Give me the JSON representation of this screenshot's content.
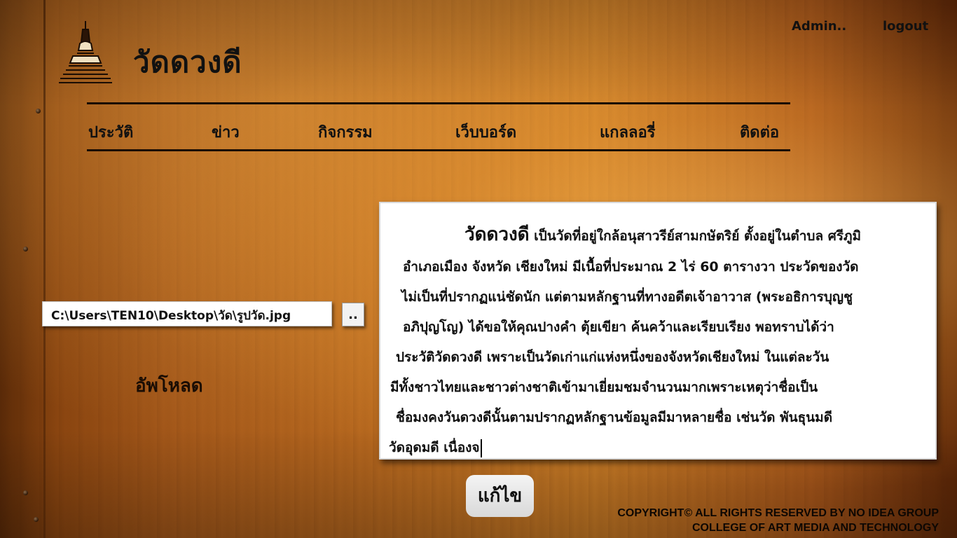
{
  "site": {
    "title": "วัดดวงดี",
    "logo_icon": "pagoda-icon"
  },
  "user": {
    "admin_label": "Admin..",
    "logout_label": "logout"
  },
  "nav": {
    "items": [
      {
        "label": "ประวัติ"
      },
      {
        "label": "ข่าว"
      },
      {
        "label": "กิจกรรม"
      },
      {
        "label": "เว็บบอร์ด"
      },
      {
        "label": "แกลลอรี่"
      },
      {
        "label": "ติดต่อ"
      }
    ]
  },
  "upload": {
    "file_path": "C:\\Users\\TEN10\\Desktop\\วัด\\รูปวัด.jpg",
    "browse_label": "..",
    "upload_label": "อัพโหลด"
  },
  "history": {
    "lead": "วัดดวงดี",
    "lines": [
      " เป็นวัดที่อยู่ใกล้อนุสาวรีย์สามกษัตริย์ ตั้งอยู่ในตำบล ศรีภูมิ",
      "อำเภอเมือง จังหวัด เชียงใหม่ มีเนื้อที่ประมาณ 2 ไร่ 60 ตารางวา ประวัดของวัด",
      "ไม่เป็นที่ปรากฏแน่ชัดนัก แต่ตามหลักฐานที่ทางอดีตเจ้าอาวาส (พระอธิการบุญชู",
      "อภิปุญโญ) ได้ขอให้คุณปางคำ ตุ้ยเขียา ค้นคว้าและเรียบเรียง พอทราบได้ว่า",
      "ประวัติวัดดวงดี เพราะเป็นวัดเก่าแก่แห่งหนึ่งของจังหวัดเชียงใหม่ ในแต่ละวัน",
      "มีทั้งชาวไทยและชาวต่างชาติเข้ามาเยี่ยมชมจำนวนมากเพราะเหตุว่าชื่อเป็น",
      "ชื่อมงคงวันดวงดีนั้นตามปรากฏหลักฐานข้อมูลมีมาหลายชื่อ เช่นวัด พันธุนมดี",
      "วัดอุดมดี เนื่องจ"
    ]
  },
  "actions": {
    "save_label": "แก้ไข"
  },
  "footer": {
    "line1": "COPYRIGHT©  ALL RIGHTS RESERVED BY NO IDEA GROUP",
    "line2": "COLLEGE OF ART MEDIA AND TECHNOLOGY"
  }
}
